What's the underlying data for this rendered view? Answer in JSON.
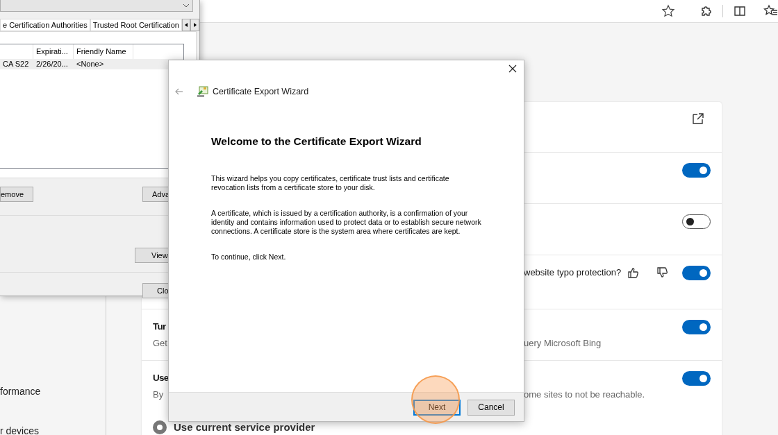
{
  "sidebar": {
    "items": [
      "formance",
      "r devices"
    ]
  },
  "settings_rows": [
    {
      "kind": "link"
    },
    {
      "kind": "toggle",
      "on": true
    },
    {
      "kind": "toggle",
      "on": false
    },
    {
      "kind": "feedback",
      "title_right": "website typo protection?",
      "on": true
    },
    {
      "kind": "toggle",
      "title": "Tur",
      "desc": "Get",
      "desc_right": "uery Microsoft Bing",
      "on": true
    },
    {
      "kind": "toggle",
      "title": "Use",
      "desc": "By",
      "desc_right": "ome sites to not be reachable.",
      "on": true,
      "radio": {
        "label": "Use current service provider",
        "selected": true
      }
    }
  ],
  "certificates_dialog": {
    "tabs": [
      "e Certification Authorities",
      "Trusted Root Certification"
    ],
    "columns": [
      "",
      "Expirati...",
      "Friendly Name"
    ],
    "rows": [
      {
        "cells": [
          "CA S22",
          "2/26/20...",
          "<None>"
        ],
        "selected": true
      }
    ],
    "buttons": [
      "emove",
      "Adva"
    ],
    "view_button": "View",
    "close_button": "Clo"
  },
  "wizard": {
    "title": "Certificate Export Wizard",
    "heading": "Welcome to the Certificate Export Wizard",
    "paragraphs": [
      "This wizard helps you copy certificates, certificate trust lists and certificate revocation lists from a certificate store to your disk.",
      "A certificate, which is issued by a certification authority, is a confirmation of your identity and contains information used to protect data or to establish secure network connections. A certificate store is the system area where certificates are kept.",
      "To continue, click Next."
    ],
    "buttons": [
      {
        "label": "Next",
        "default": true,
        "highlighted": true
      },
      {
        "label": "Cancel",
        "default": false,
        "highlighted": false
      }
    ]
  }
}
